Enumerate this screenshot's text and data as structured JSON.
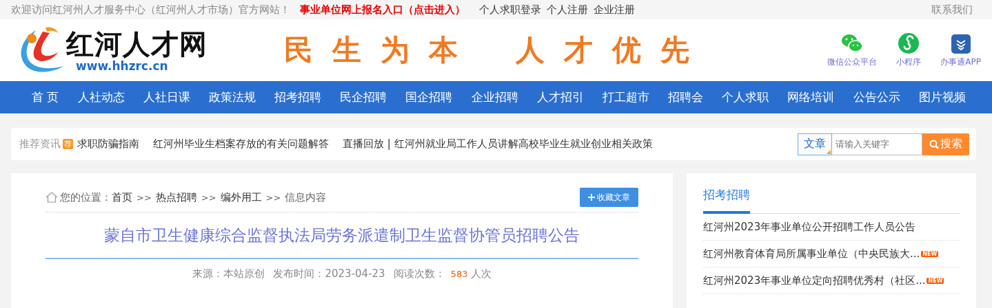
{
  "top_bar": {
    "welcome": "欢迎访问红河州人才服务中心（红河州人才市场）官方网站！",
    "highlight_link": "事业单位网上报名入口（点击进入）",
    "links": [
      "个人求职登录",
      "个人注册",
      "企业注册"
    ],
    "contact": "联系我们"
  },
  "header": {
    "logo_text": "红河人才网",
    "logo_url": "www.hhzrc.cn",
    "slogan": [
      "民生为本",
      "人才优先"
    ],
    "apps": [
      {
        "kind": "wechat",
        "label": "微信公众平台"
      },
      {
        "kind": "miniprogram",
        "label": "小程序"
      },
      {
        "kind": "app",
        "label": "办事通APP"
      }
    ]
  },
  "nav": [
    "首 页",
    "人社动态",
    "人社日课",
    "政策法规",
    "招考招聘",
    "民企招聘",
    "国企招聘",
    "企业招聘",
    "人才招引",
    "打工超市",
    "招聘会",
    "个人求职",
    "网络培训",
    "公告公示",
    "图片视频"
  ],
  "recommend": {
    "label": "推荐资讯",
    "tag": "荐",
    "items": [
      "求职防骗指南",
      "红河州毕业生档案存放的有关问题解答",
      "直播回放 | 红河州就业局工作人员讲解高校毕业生就业创业相关政策"
    ]
  },
  "search": {
    "category": "文章",
    "placeholder": "请输入关键字",
    "button": "搜索"
  },
  "article": {
    "breadcrumb_label": "您的位置：",
    "breadcrumb": [
      {
        "text": "首页",
        "sep": ">>"
      },
      {
        "text": "热点招聘",
        "sep": ">>"
      },
      {
        "text": "编外用工",
        "sep": ">>"
      },
      {
        "text": "信息内容"
      }
    ],
    "favorite_button": "收藏文章",
    "title": "蒙自市卫生健康综合监督执法局劳务派遣制卫生监督协管员招聘公告",
    "source": "来源：本站原创",
    "date": "发布时间：2023-04-23",
    "views_label": "阅读次数：",
    "views": "583",
    "views_unit": "人次"
  },
  "sidebar": {
    "title": "招考招聘",
    "items": [
      {
        "text": "红河州2023年事业单位公开招聘工作人员公告"
      },
      {
        "text": "红河州教育体育局所属事业单位（中央民族大...",
        "badge": "NEW"
      },
      {
        "text": "红河州2023年事业单位定向招聘优秀村（社区...",
        "badge": "NEW"
      }
    ]
  }
}
